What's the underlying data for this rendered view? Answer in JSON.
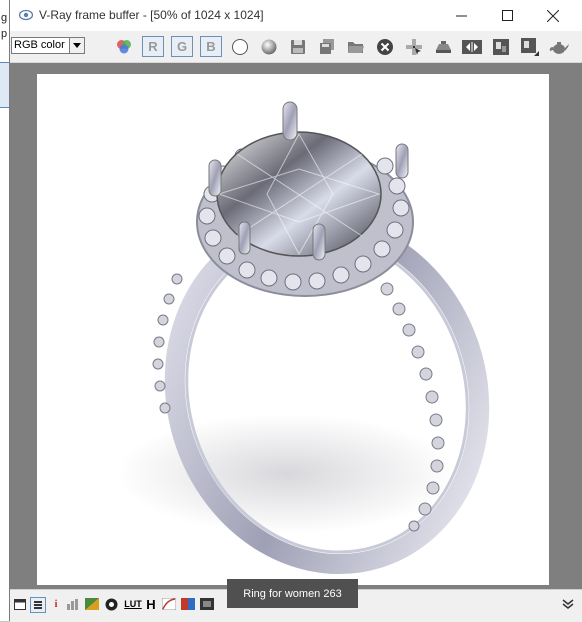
{
  "window": {
    "title": "V-Ray frame buffer - [50% of 1024 x 1024]"
  },
  "toolbar": {
    "color_channel": "RGB color",
    "channels": {
      "r": "R",
      "g": "G",
      "b": "B"
    }
  },
  "statusbar": {
    "info_glyph": "i",
    "lut_glyph": "LUT",
    "h_glyph": "H"
  },
  "tooltip": {
    "text": "Ring for women 263"
  },
  "behind_window": {
    "line1": "g",
    "line2": "p"
  },
  "icons": [
    "app-icon",
    "minimize-icon",
    "maximize-icon",
    "close-icon",
    "channels-icon",
    "mono-icon",
    "alpha-icon",
    "save-icon",
    "save-all-icon",
    "load-icon",
    "clear-icon",
    "track-mouse-icon",
    "render-region-icon",
    "compare-icon",
    "link-icon",
    "history-icon",
    "teapot-icon",
    "chevron-double-down-icon"
  ],
  "colors": {
    "accent": "#6e8fb8",
    "viewport": "#7f7f7f",
    "tooltip": "#505050"
  }
}
